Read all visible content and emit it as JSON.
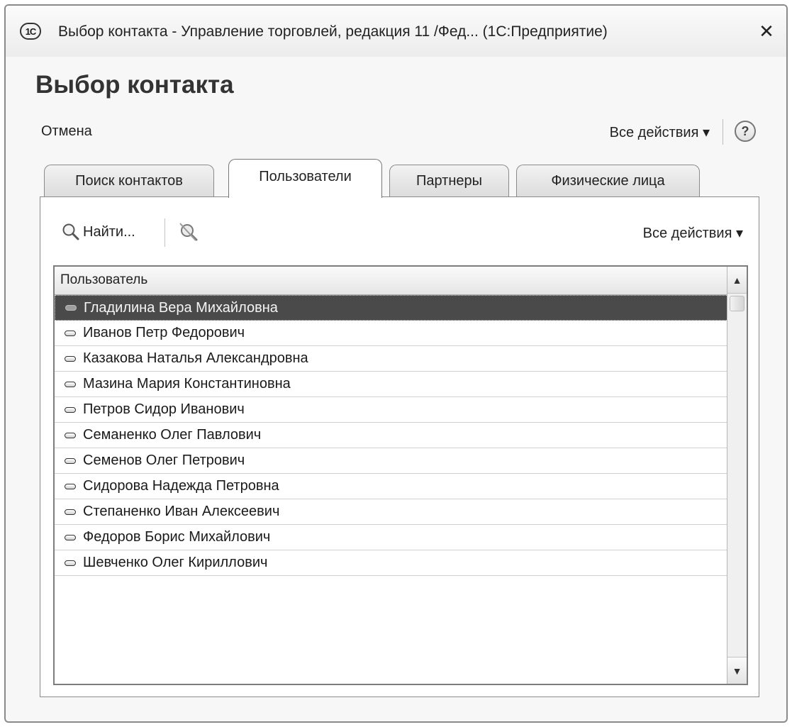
{
  "window": {
    "logo": "1С",
    "title": "Выбор контакта - Управление торговлей, редакция 11 /Фед... (1С:Предприятие)",
    "close_label": "✕"
  },
  "form": {
    "title": "Выбор контакта",
    "cancel_label": "Отмена",
    "all_actions_label": "Все действия ▾",
    "help_label": "?"
  },
  "tabs": [
    {
      "label": "Поиск контактов",
      "active": false
    },
    {
      "label": "Пользователи",
      "active": true
    },
    {
      "label": "Партнеры",
      "active": false
    },
    {
      "label": "Физические лица",
      "active": false
    }
  ],
  "toolbar": {
    "find_label": "Найти...",
    "all_actions_label": "Все действия ▾"
  },
  "table": {
    "column_header": "Пользователь",
    "selected_index": 0,
    "rows": [
      "Гладилина Вера Михайловна",
      "Иванов Петр Федорович",
      "Казакова Наталья Александровна",
      "Мазина Мария Константиновна",
      "Петров Сидор Иванович",
      "Семаненко Олег Павлович",
      "Семенов Олег Петрович",
      "Сидорова Надежда Петровна",
      "Степаненко Иван Алексеевич",
      "Федоров Борис Михайлович",
      "Шевченко Олег Кириллович"
    ]
  },
  "scrollbar": {
    "up": "▲",
    "down": "▼"
  },
  "icons": {
    "app_logo": "1c-logo-icon",
    "find": "magnifier-icon",
    "clear_search": "clear-search-icon",
    "row_marker": "minus-icon",
    "help": "help-icon"
  }
}
